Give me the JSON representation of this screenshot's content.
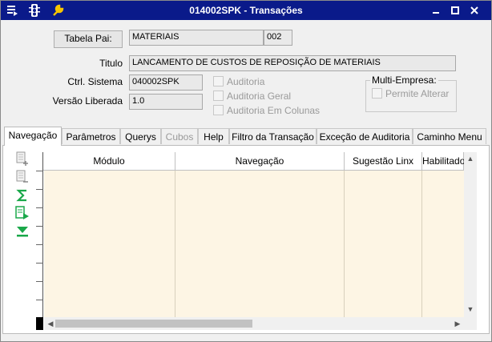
{
  "window": {
    "title": "014002SPK - Transações"
  },
  "form": {
    "tabela_pai_button": "Tabela Pai:",
    "tabela_pai_value": "MATERIAIS",
    "tabela_pai_code": "002",
    "titulo_label": "Titulo",
    "titulo_value": "LANCAMENTO DE CUSTOS DE REPOSIÇÃO DE MATERIAIS",
    "ctrl_sistema_label": "Ctrl. Sistema",
    "ctrl_sistema_value": "040002SPK",
    "versao_label": "Versão Liberada",
    "versao_value": "1.0",
    "auditoria": "Auditoria",
    "auditoria_geral": "Auditoria Geral",
    "auditoria_colunas": "Auditoria Em Colunas",
    "multi_empresa_title": "Multi-Empresa:",
    "permite_alterar": "Permite Alterar"
  },
  "tabs": [
    {
      "label": "Navegação",
      "active": true,
      "enabled": true
    },
    {
      "label": "Parâmetros",
      "active": false,
      "enabled": true
    },
    {
      "label": "Querys",
      "active": false,
      "enabled": true
    },
    {
      "label": "Cubos",
      "active": false,
      "enabled": false
    },
    {
      "label": "Help",
      "active": false,
      "enabled": true
    },
    {
      "label": "Filtro da Transação",
      "active": false,
      "enabled": true
    },
    {
      "label": "Exceção de Auditoria",
      "active": false,
      "enabled": true
    },
    {
      "label": "Caminho Menu",
      "active": false,
      "enabled": true
    }
  ],
  "grid": {
    "columns": [
      "Módulo",
      "Navegação",
      "Sugestão Linx",
      "Habilitado"
    ],
    "rows": []
  },
  "icons": {
    "titlebar": [
      "menu-icon",
      "traffic-light-icon",
      "wrench-icon"
    ],
    "side": [
      "add-row-icon",
      "remove-row-icon",
      "sum-icon",
      "export-icon",
      "expand-down-icon"
    ]
  },
  "colors": {
    "titlebar": "#0a1a8a",
    "grid_background": "#fdf5e4",
    "accent_green": "#1aa84a"
  }
}
